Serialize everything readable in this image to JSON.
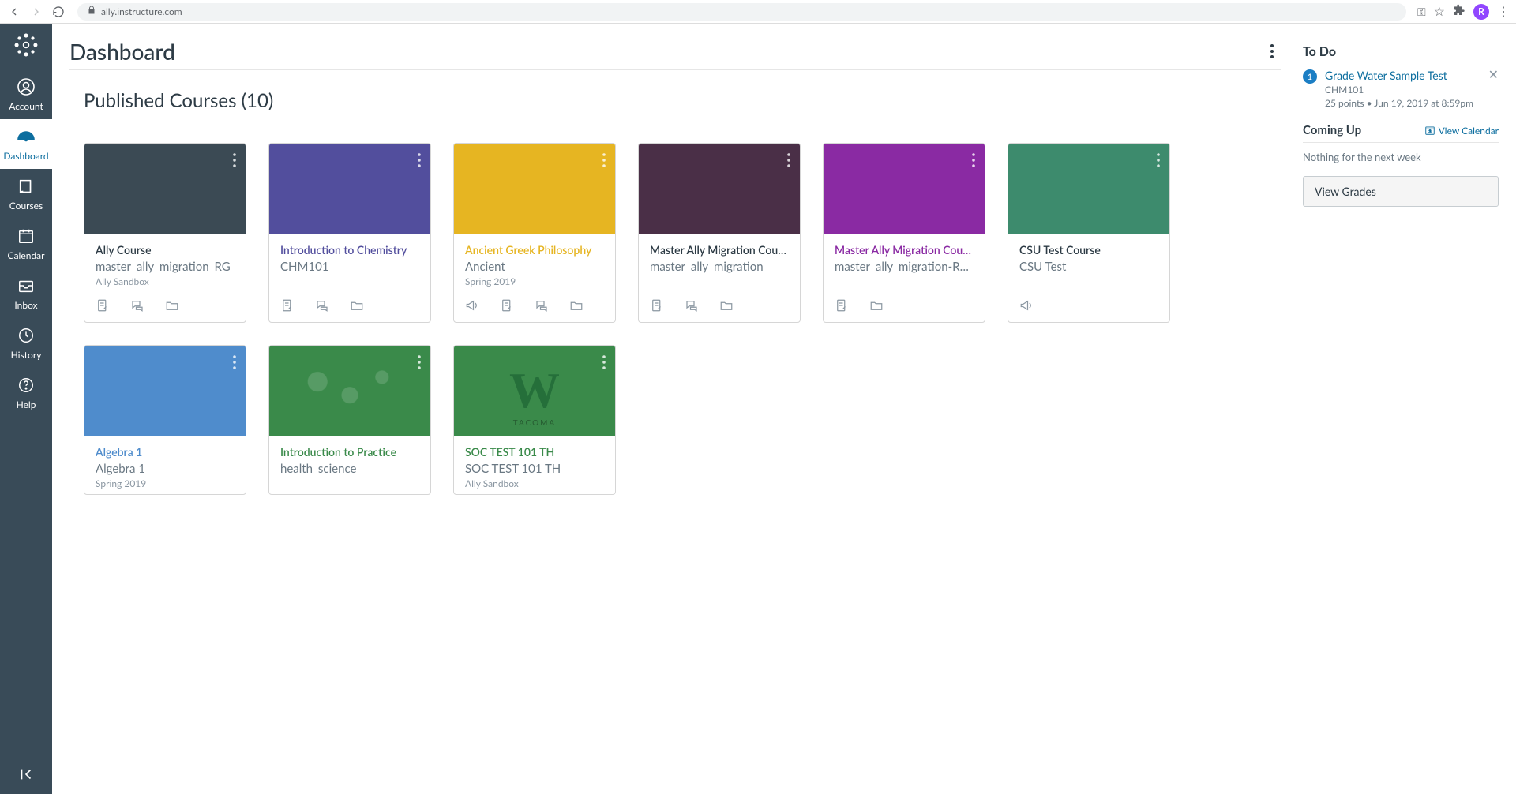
{
  "browser": {
    "url": "ally.instructure.com",
    "avatar_letter": "R"
  },
  "nav": {
    "account": "Account",
    "dashboard": "Dashboard",
    "courses": "Courses",
    "calendar": "Calendar",
    "inbox": "Inbox",
    "history": "History",
    "help": "Help"
  },
  "dashboard": {
    "title": "Dashboard",
    "section_title": "Published Courses (10)"
  },
  "courses": [
    {
      "title": "Ally Course",
      "color": "#3b4a54",
      "text_color": "#2d3b45",
      "sub": "master_ally_migration_RG",
      "term": "Ally Sandbox",
      "icons": [
        "assignment",
        "discussion",
        "files"
      ],
      "bg": ""
    },
    {
      "title": "Introduction to Chemistry",
      "color": "#524e9d",
      "text_color": "#524e9d",
      "sub": "CHM101",
      "term": "",
      "icons": [
        "assignment",
        "discussion",
        "files"
      ],
      "bg": ""
    },
    {
      "title": "Ancient Greek Philosophy",
      "color": "#e6b522",
      "text_color": "#e6b522",
      "sub": "Ancient",
      "term": "Spring 2019",
      "icons": [
        "announce",
        "assignment",
        "discussion",
        "files"
      ],
      "bg": ""
    },
    {
      "title": "Master Ally Migration Course--AJW",
      "color": "#4a2f47",
      "text_color": "#2d3b45",
      "sub": "master_ally_migration",
      "term": "",
      "icons": [
        "assignment",
        "discussion",
        "files"
      ],
      "bg": ""
    },
    {
      "title": "Master Ally Migration Course--RM...",
      "color": "#8a2aa3",
      "text_color": "#8a2aa3",
      "sub": "master_ally_migration-RMIT",
      "term": "",
      "icons": [
        "assignment",
        "files"
      ],
      "bg": ""
    },
    {
      "title": "CSU Test Course",
      "color": "#3d8b6d",
      "text_color": "#2d3b45",
      "sub": "CSU Test",
      "term": "",
      "icons": [
        "announce"
      ],
      "bg": ""
    },
    {
      "title": "Algebra 1",
      "color": "#4f8ccc",
      "text_color": "#4f8ccc",
      "sub": "Algebra 1",
      "term": "Spring 2019",
      "icons": [],
      "bg": ""
    },
    {
      "title": "Introduction to Practice",
      "color": "#3a8a4a",
      "text_color": "#3a8a4a",
      "sub": "health_science",
      "term": "",
      "icons": [],
      "bg": "green"
    },
    {
      "title": "SOC TEST 101 TH",
      "color": "#3a8a4a",
      "text_color": "#3a8a4a",
      "sub": "SOC TEST 101 TH",
      "term": "Ally Sandbox",
      "icons": [],
      "bg": "w"
    }
  ],
  "side": {
    "todo_heading": "To Do",
    "todo": {
      "badge": "1",
      "link": "Grade Water Sample Test",
      "course": "CHM101",
      "meta": "25 points • Jun 19, 2019 at 8:59pm"
    },
    "coming_heading": "Coming Up",
    "view_calendar": "View Calendar",
    "coming_text": "Nothing for the next week",
    "view_grades": "View Grades"
  }
}
